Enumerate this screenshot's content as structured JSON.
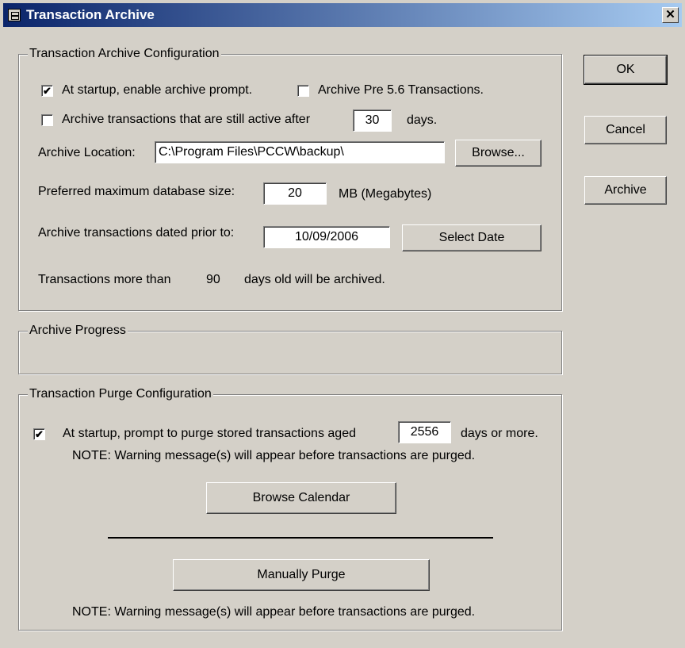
{
  "window": {
    "title": "Transaction Archive",
    "close_glyph": "✕"
  },
  "buttons": {
    "ok": "OK",
    "cancel": "Cancel",
    "archive": "Archive"
  },
  "archive_config": {
    "group_label": "Transaction Archive Configuration",
    "enable_prompt": {
      "label": "At startup, enable archive prompt.",
      "checked": true,
      "mark": "✔"
    },
    "pre56": {
      "label": "Archive Pre 5.6 Transactions.",
      "checked": false
    },
    "still_active": {
      "label": "Archive transactions that are still active after",
      "checked": false,
      "days_value": "30",
      "days_label": "days."
    },
    "location": {
      "label": "Archive Location:",
      "value": "C:\\Program Files\\PCCW\\backup\\",
      "browse": "Browse..."
    },
    "max_db": {
      "label": "Preferred maximum database size:",
      "value": "20",
      "unit": "MB (Megabytes)"
    },
    "dated_prior": {
      "label": "Archive transactions dated prior to:",
      "value": "10/09/2006",
      "select_date": "Select Date"
    },
    "summary": {
      "prefix": "Transactions more than",
      "days": "90",
      "suffix": "days old will be archived."
    }
  },
  "archive_progress": {
    "group_label": "Archive Progress"
  },
  "purge_config": {
    "group_label": "Transaction Purge Configuration",
    "prompt": {
      "label": "At startup, prompt to purge stored transactions aged",
      "checked": true,
      "mark": "✔",
      "days_value": "2556",
      "days_label": "days or more."
    },
    "note1": "NOTE:  Warning message(s) will appear before transactions are purged.",
    "browse_calendar": "Browse Calendar",
    "manually_purge": "Manually Purge",
    "note2": "NOTE:  Warning message(s) will appear before transactions are purged."
  }
}
